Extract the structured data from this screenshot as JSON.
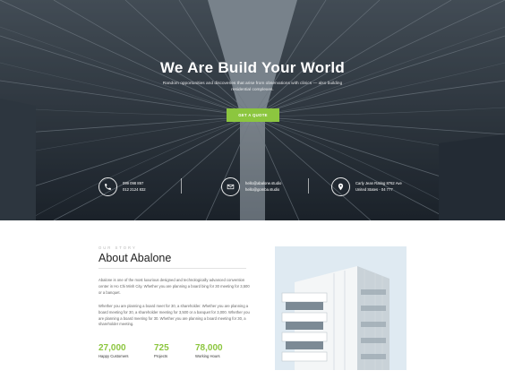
{
  "hero": {
    "title": "We Are Build Your World",
    "subtitle": "Random opportunities and discoveries that arise from observations with clinics — also building residential complexes.",
    "cta_label": "GET A QUOTE"
  },
  "contacts": [
    {
      "icon": "phone-icon",
      "lines": [
        "099 098 897",
        "012 2124 832"
      ]
    },
    {
      "icon": "mail-icon",
      "lines": [
        "hello@abalone.studio",
        "hello@gomba.studio"
      ]
    },
    {
      "icon": "location-pin-icon",
      "lines": [
        "Carly Jean Rating 8762 Ave",
        "United States - 04 777"
      ]
    }
  ],
  "about": {
    "kicker": "OUR STORY",
    "title": "About Abalone",
    "paragraph1": "Abalone is one of the most luxurious designed and technologically advanced convention center in Ho Chi Minh City. Whether you are planning a board bing for 30 meeting for 3,500 or a banquet.",
    "paragraph2": "Whether you are planning a board meet for 30, a shareholder. Whether you are planning a board meeting for 30, a shareholder meeting for 3,500 or a banquet for 3,000. Whether you are planning a board meeting for 30. Whether you are planning a board meeting for 30, a shareholder meeting."
  },
  "stats": [
    {
      "value": "27,000",
      "label": "Happy Customers"
    },
    {
      "value": "725",
      "label": "Projects"
    },
    {
      "value": "78,000",
      "label": "Working Hours"
    }
  ],
  "colors": {
    "accent": "#8cc63f",
    "title": "#222222"
  }
}
